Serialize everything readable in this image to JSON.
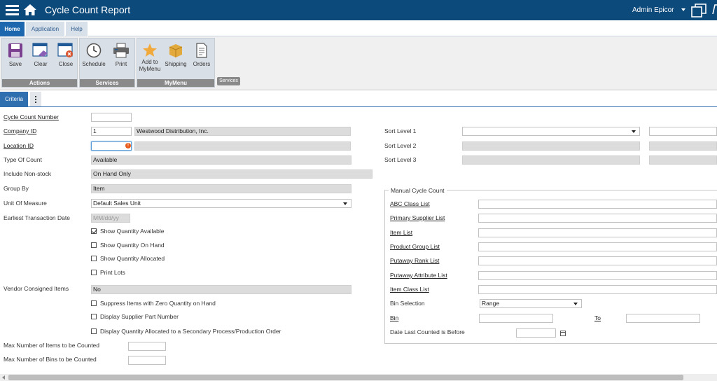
{
  "header": {
    "title": "Cycle Count Report",
    "user": "Admin Epicor",
    "brand_color": "#0d4a7c"
  },
  "menu_tabs": [
    {
      "label": "Home",
      "active": true
    },
    {
      "label": "Application",
      "active": false
    },
    {
      "label": "Help",
      "active": false
    }
  ],
  "ribbon": {
    "groups": [
      {
        "label": "Actions",
        "buttons": [
          "Save",
          "Clear",
          "Close"
        ]
      },
      {
        "label": "Services",
        "buttons": [
          "Schedule",
          "Print"
        ]
      },
      {
        "label": "MyMenu",
        "buttons": [
          "Add to MyMenu",
          "Shipping",
          "Orders"
        ]
      }
    ],
    "services_tag": "Services"
  },
  "subtabs": {
    "criteria": "Criteria"
  },
  "form": {
    "cycle_count_number": {
      "label": "Cycle Count Number",
      "value": ""
    },
    "company_id": {
      "label": "Company ID",
      "value": "1",
      "name": "Westwood Distribution, Inc."
    },
    "location_id": {
      "label": "Location ID",
      "value": ""
    },
    "type_of_count": {
      "label": "Type Of Count",
      "value": "Available"
    },
    "include_non_stock": {
      "label": "Include Non-stock",
      "value": "On Hand Only"
    },
    "group_by": {
      "label": "Group By",
      "value": "Item"
    },
    "unit_of_measure": {
      "label": "Unit Of Measure",
      "value": "Default Sales Unit"
    },
    "earliest_transaction_date": {
      "label": "Earliest Transaction Date",
      "placeholder": "MM/dd/yy"
    },
    "show_quantity_available": {
      "label": "Show Quantity Available",
      "checked": true
    },
    "show_quantity_on_hand": {
      "label": "Show Quantity On Hand",
      "checked": false
    },
    "show_quantity_allocated": {
      "label": "Show Quantity Allocated",
      "checked": false
    },
    "print_lots": {
      "label": "Print Lots",
      "checked": false
    },
    "vendor_consigned_items": {
      "label": "Vendor Consigned Items",
      "value": "No"
    },
    "suppress_zero_qty": {
      "label": "Suppress Items with Zero Quantity on Hand",
      "checked": false
    },
    "display_supplier_part": {
      "label": "Display Supplier Part Number",
      "checked": false
    },
    "display_qty_allocated_secondary": {
      "label": "Display Quantity Allocated to a Secondary Process/Production Order",
      "checked": false
    },
    "max_items": {
      "label": "Max Number of Items to be Counted",
      "value": ""
    },
    "max_bins": {
      "label": "Max Number of Bins to be Counted",
      "value": ""
    }
  },
  "sort": {
    "level1": {
      "label": "Sort Level 1",
      "value": ""
    },
    "level2": {
      "label": "Sort Level 2",
      "value": ""
    },
    "level3": {
      "label": "Sort Level 3",
      "value": ""
    }
  },
  "manual_cycle_count": {
    "legend": "Manual Cycle Count",
    "abc_class_list": "ABC Class List",
    "primary_supplier_list": "Primary Supplier List",
    "item_list": "Item List",
    "product_group_list": "Product Group List",
    "putaway_rank_list": "Putaway Rank List",
    "putaway_attribute_list": "Putaway Attribute List",
    "item_class_list": "Item Class List",
    "bin_selection": {
      "label": "Bin Selection",
      "value": "Range"
    },
    "bin": {
      "label": "Bin",
      "value": ""
    },
    "to": {
      "label": "To",
      "value": ""
    },
    "date_last_counted": {
      "label": "Date Last Counted is Before",
      "value": ""
    }
  }
}
